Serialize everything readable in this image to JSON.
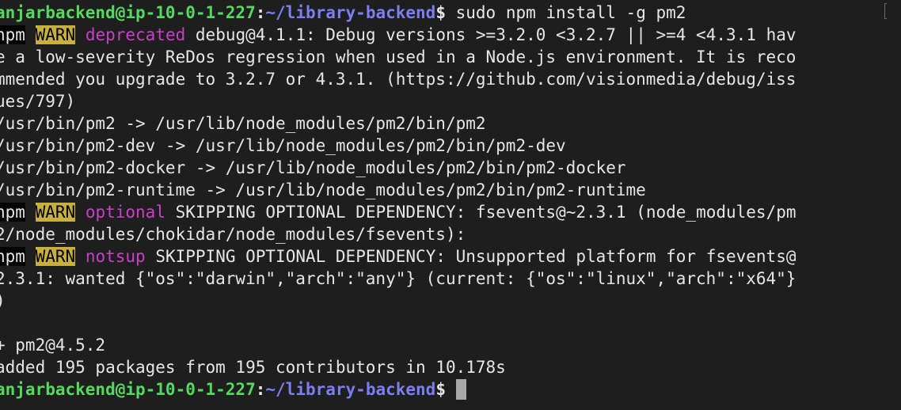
{
  "prompt": {
    "user_host": "anjarbackend@ip-10-0-1-227",
    "separator": ":",
    "path": "~/library-backend",
    "symbol": "$ "
  },
  "command": "sudo npm install -g pm2",
  "warnings": {
    "npm_label": "npm",
    "warn_label": "WARN",
    "deprecated": {
      "level": "deprecated",
      "lines": [
        " debug@4.1.1: Debug versions >=3.2.0 <3.2.7 || >=4 <4.3.1 hav",
        "e a low-severity ReDos regression when used in a Node.js environment. It is reco",
        "mmended you upgrade to 3.2.7 or 4.3.1. (https://github.com/visionmedia/debug/iss",
        "ues/797)"
      ]
    },
    "optional": {
      "level": "optional",
      "lines": [
        " SKIPPING OPTIONAL DEPENDENCY: fsevents@~2.3.1 (node_modules/pm",
        "2/node_modules/chokidar/node_modules/fsevents):"
      ]
    },
    "notsup": {
      "level": "notsup",
      "lines": [
        " SKIPPING OPTIONAL DEPENDENCY: Unsupported platform for fsevents@",
        "2.3.1: wanted {\"os\":\"darwin\",\"arch\":\"any\"} (current: {\"os\":\"linux\",\"arch\":\"x64\"}",
        ")"
      ]
    }
  },
  "links": [
    "/usr/bin/pm2 -> /usr/lib/node_modules/pm2/bin/pm2",
    "/usr/bin/pm2-dev -> /usr/lib/node_modules/pm2/bin/pm2-dev",
    "/usr/bin/pm2-docker -> /usr/lib/node_modules/pm2/bin/pm2-docker",
    "/usr/bin/pm2-runtime -> /usr/lib/node_modules/pm2/bin/pm2-runtime"
  ],
  "result": {
    "installed": "+ pm2@4.5.2",
    "summary": "added 195 packages from 195 contributors in 10.178s"
  },
  "colors": {
    "background": "#1e1e1e",
    "text": "#e6e6e6",
    "user_host": "#56d860",
    "path": "#7b7ff0",
    "warn_bg": "#c8b03c",
    "level": "#c940c8",
    "cursor": "#a8a8a8"
  }
}
